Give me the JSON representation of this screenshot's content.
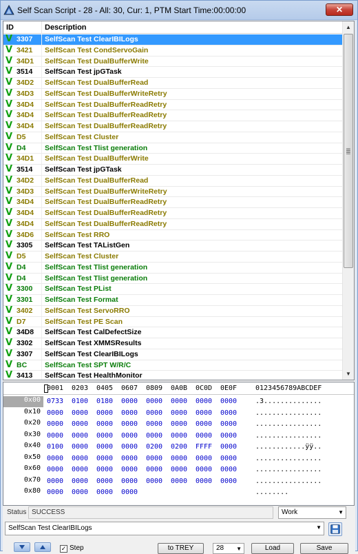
{
  "window": {
    "title": "Self Scan Script - 28 - All: 30, Cur: 1, PTM Start Time:00:00:00",
    "close_label": "✕"
  },
  "list": {
    "columns": [
      "ID",
      "Description"
    ],
    "rows": [
      {
        "id": "3307",
        "desc": "SelfScan Test ClearIBILogs",
        "color": "black",
        "selected": true
      },
      {
        "id": "3421",
        "desc": "SelfScan Test CondServoGain",
        "color": "olive"
      },
      {
        "id": "34D1",
        "desc": "SelfScan Test DualBufferWrite",
        "color": "olive"
      },
      {
        "id": "3514",
        "desc": "SelfScan Test jpGTask",
        "color": "black"
      },
      {
        "id": "34D2",
        "desc": "SelfScan Test DualBufferRead",
        "color": "olive"
      },
      {
        "id": "34D3",
        "desc": "SelfScan Test DualBufferWriteRetry",
        "color": "olive"
      },
      {
        "id": "34D4",
        "desc": "SelfScan Test DualBufferReadRetry",
        "color": "olive"
      },
      {
        "id": "34D4",
        "desc": "SelfScan Test DualBufferReadRetry",
        "color": "olive"
      },
      {
        "id": "34D4",
        "desc": "SelfScan Test DualBufferReadRetry",
        "color": "olive"
      },
      {
        "id": "D5",
        "desc": "SelfScan Test Cluster",
        "color": "olive"
      },
      {
        "id": "D4",
        "desc": "SelfScan Test Tlist generation",
        "color": "green"
      },
      {
        "id": "34D1",
        "desc": "SelfScan Test DualBufferWrite",
        "color": "olive"
      },
      {
        "id": "3514",
        "desc": "SelfScan Test jpGTask",
        "color": "black"
      },
      {
        "id": "34D2",
        "desc": "SelfScan Test DualBufferRead",
        "color": "olive"
      },
      {
        "id": "34D3",
        "desc": "SelfScan Test DualBufferWriteRetry",
        "color": "olive"
      },
      {
        "id": "34D4",
        "desc": "SelfScan Test DualBufferReadRetry",
        "color": "olive"
      },
      {
        "id": "34D4",
        "desc": "SelfScan Test DualBufferReadRetry",
        "color": "olive"
      },
      {
        "id": "34D4",
        "desc": "SelfScan Test DualBufferReadRetry",
        "color": "olive"
      },
      {
        "id": "34D6",
        "desc": "SelfScan Test RRO",
        "color": "olive"
      },
      {
        "id": "3305",
        "desc": "SelfScan Test TAListGen",
        "color": "black"
      },
      {
        "id": "D5",
        "desc": "SelfScan Test Cluster",
        "color": "olive"
      },
      {
        "id": "D4",
        "desc": "SelfScan Test Tlist generation",
        "color": "green"
      },
      {
        "id": "D4",
        "desc": "SelfScan Test Tlist generation",
        "color": "green"
      },
      {
        "id": "3300",
        "desc": "SelfScan Test PList",
        "color": "green"
      },
      {
        "id": "3301",
        "desc": "SelfScan Test Format",
        "color": "green"
      },
      {
        "id": "3402",
        "desc": "SelfScan Test ServoRRO",
        "color": "olive"
      },
      {
        "id": "D7",
        "desc": "SelfScan Test PE Scan",
        "color": "olive"
      },
      {
        "id": "34D8",
        "desc": "SelfScan Test CalDefectSize",
        "color": "black"
      },
      {
        "id": "3302",
        "desc": "SelfScan Test XMMSResults",
        "color": "black"
      },
      {
        "id": "3307",
        "desc": "SelfScan Test ClearIBILogs",
        "color": "black"
      },
      {
        "id": "BC",
        "desc": "SelfScan Test SPT W/R/C",
        "color": "green"
      },
      {
        "id": "3413",
        "desc": "SelfScan Test HealthMonitor",
        "color": "black"
      }
    ]
  },
  "hex": {
    "columns": [
      "0001",
      "0203",
      "0405",
      "0607",
      "0809",
      "0A0B",
      "0C0D",
      "0E0F"
    ],
    "ascii_header": "0123456789ABCDEF",
    "rows": [
      {
        "addr": "0x00",
        "vals": [
          "0733",
          "0100",
          "0180",
          "0000",
          "0000",
          "0000",
          "0000",
          "0000"
        ],
        "ascii": ".3..............",
        "selected": true
      },
      {
        "addr": "0x10",
        "vals": [
          "0000",
          "0000",
          "0000",
          "0000",
          "0000",
          "0000",
          "0000",
          "0000"
        ],
        "ascii": "................"
      },
      {
        "addr": "0x20",
        "vals": [
          "0000",
          "0000",
          "0000",
          "0000",
          "0000",
          "0000",
          "0000",
          "0000"
        ],
        "ascii": "................"
      },
      {
        "addr": "0x30",
        "vals": [
          "0000",
          "0000",
          "0000",
          "0000",
          "0000",
          "0000",
          "0000",
          "0000"
        ],
        "ascii": "................"
      },
      {
        "addr": "0x40",
        "vals": [
          "0100",
          "0000",
          "0000",
          "0000",
          "0200",
          "0200",
          "FFFF",
          "0000"
        ],
        "ascii": "............ÿÿ.."
      },
      {
        "addr": "0x50",
        "vals": [
          "0000",
          "0000",
          "0000",
          "0000",
          "0000",
          "0000",
          "0000",
          "0000"
        ],
        "ascii": "................"
      },
      {
        "addr": "0x60",
        "vals": [
          "0000",
          "0000",
          "0000",
          "0000",
          "0000",
          "0000",
          "0000",
          "0000"
        ],
        "ascii": "................"
      },
      {
        "addr": "0x70",
        "vals": [
          "0000",
          "0000",
          "0000",
          "0000",
          "0000",
          "0000",
          "0000",
          "0000"
        ],
        "ascii": "................"
      },
      {
        "addr": "0x80",
        "vals": [
          "0000",
          "0000",
          "0000",
          "0000"
        ],
        "ascii": "........"
      }
    ]
  },
  "status": {
    "label": "Status",
    "value": "SUCCESS",
    "mode": "Work"
  },
  "script_select": "SelfScan Test ClearIBILogs",
  "toolbar": {
    "step_label": "Step",
    "step_checked": "✓",
    "to_trey_label": "to TREY",
    "count": "28",
    "load_label": "Load",
    "save_label": "Save"
  }
}
